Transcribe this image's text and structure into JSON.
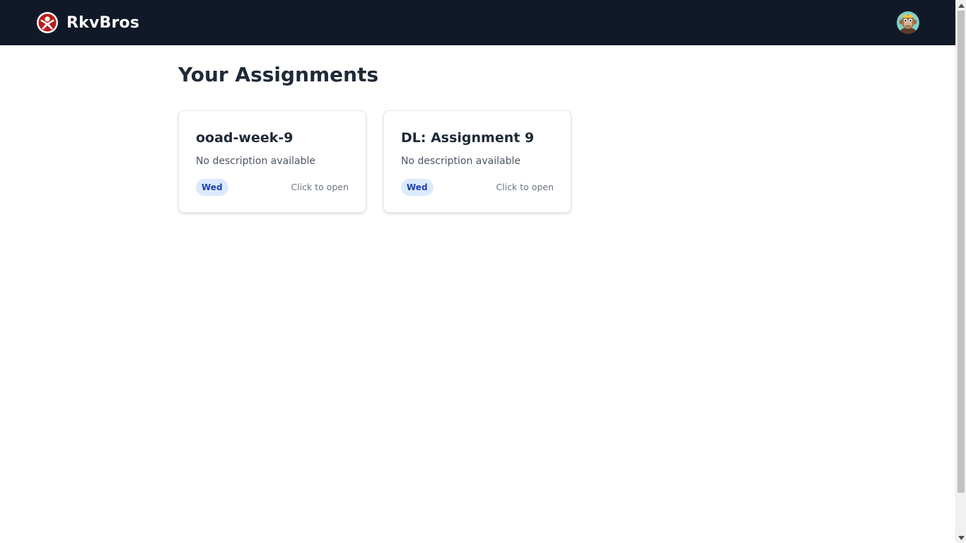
{
  "navbar": {
    "brand_name": "RkvBros",
    "logo_icon": "rkvbros-logo-icon",
    "avatar_icon": "user-avatar"
  },
  "main": {
    "title": "Your Assignments",
    "assignments": [
      {
        "title": "ooad-week-9",
        "description": "No description available",
        "day_badge": "Wed",
        "cta": "Click to open"
      },
      {
        "title": "DL: Assignment 9",
        "description": "No description available",
        "day_badge": "Wed",
        "cta": "Click to open"
      }
    ]
  },
  "colors": {
    "navbar_bg": "#111827",
    "badge_bg": "#dbeafe",
    "badge_text": "#1e40af",
    "logo_red": "#b91c1c"
  }
}
